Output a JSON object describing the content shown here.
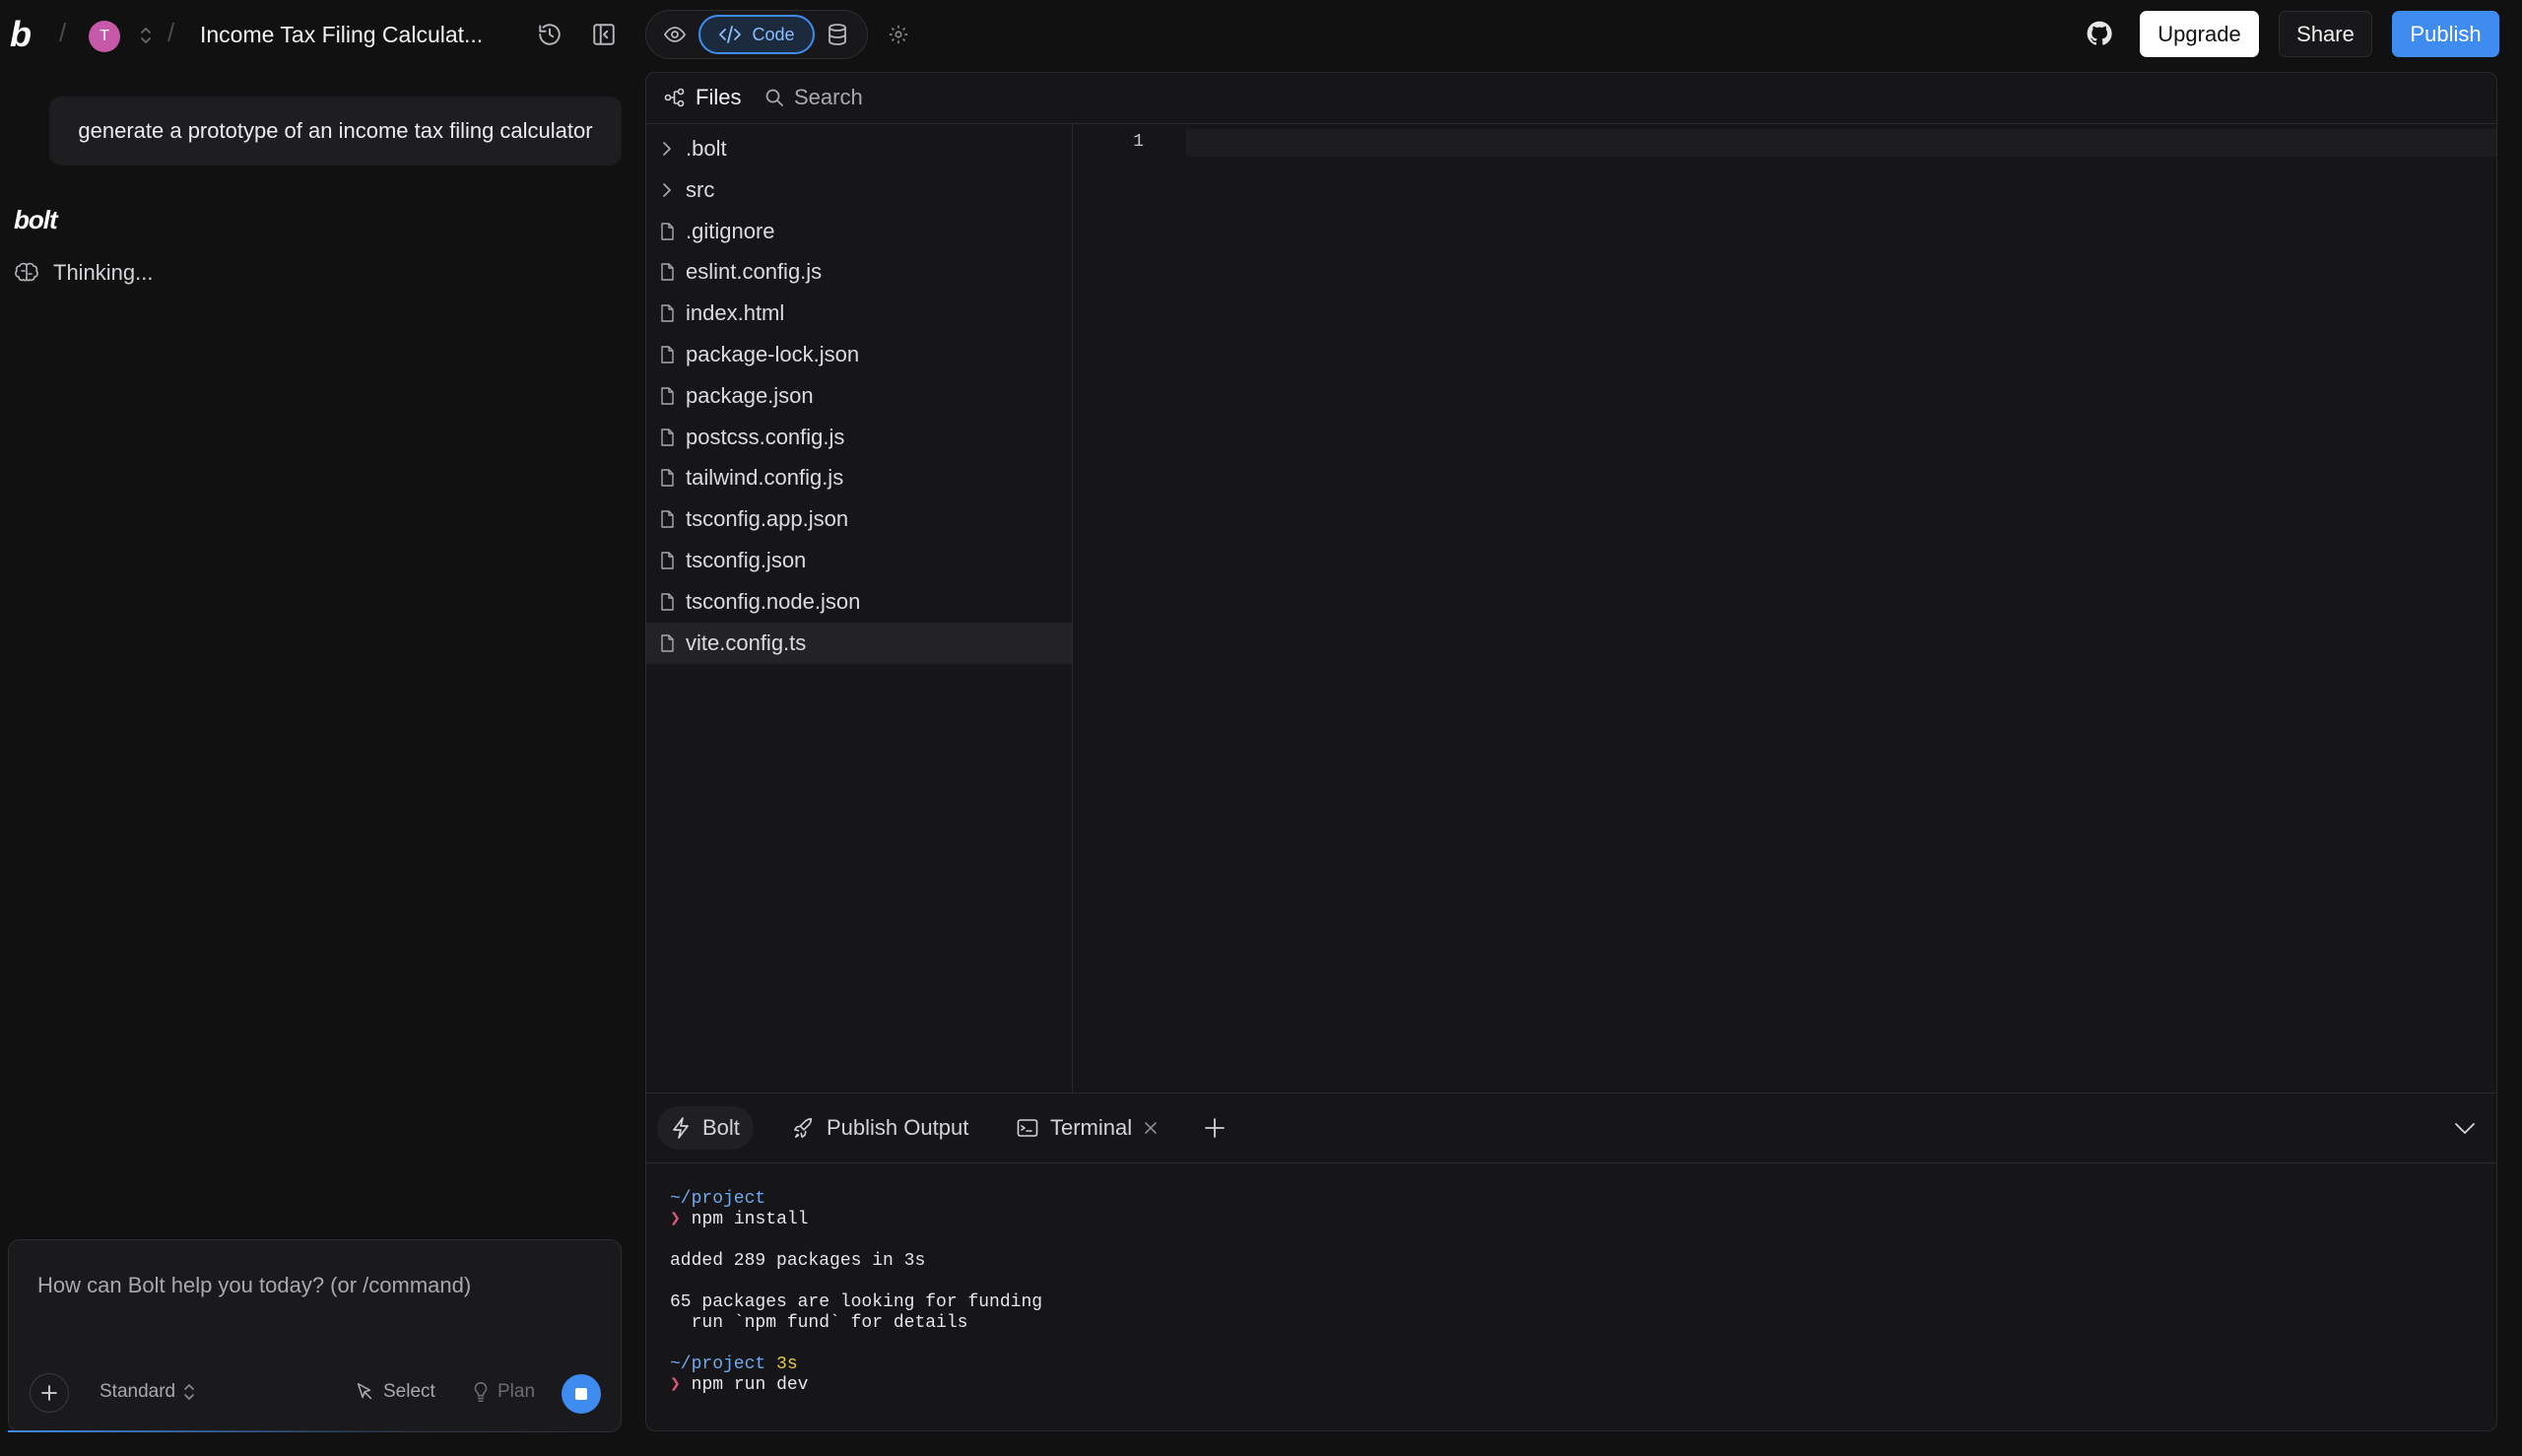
{
  "header": {
    "project_title": "Income Tax Filing Calculat...",
    "avatar_initial": "T",
    "code_label": "Code",
    "upgrade_label": "Upgrade",
    "share_label": "Share",
    "publish_label": "Publish"
  },
  "chat": {
    "user_message": "generate a prototype of an income tax filing calculator",
    "assistant_name": "bolt",
    "status": "Thinking...",
    "input_placeholder": "How can Bolt help you today? (or /command)",
    "mode_label": "Standard",
    "select_label": "Select",
    "plan_label": "Plan"
  },
  "files": {
    "files_tab": "Files",
    "search_tab": "Search",
    "items": [
      {
        "name": ".bolt",
        "type": "folder"
      },
      {
        "name": "src",
        "type": "folder"
      },
      {
        "name": ".gitignore",
        "type": "file"
      },
      {
        "name": "eslint.config.js",
        "type": "file"
      },
      {
        "name": "index.html",
        "type": "file"
      },
      {
        "name": "package-lock.json",
        "type": "file"
      },
      {
        "name": "package.json",
        "type": "file"
      },
      {
        "name": "postcss.config.js",
        "type": "file"
      },
      {
        "name": "tailwind.config.js",
        "type": "file"
      },
      {
        "name": "tsconfig.app.json",
        "type": "file"
      },
      {
        "name": "tsconfig.json",
        "type": "file"
      },
      {
        "name": "tsconfig.node.json",
        "type": "file"
      },
      {
        "name": "vite.config.ts",
        "type": "file",
        "selected": true
      }
    ]
  },
  "editor": {
    "line_number": "1"
  },
  "panel": {
    "tabs": {
      "bolt": "Bolt",
      "publish_output": "Publish Output",
      "terminal": "Terminal"
    },
    "terminal": {
      "path1": "~/project",
      "prompt_symbol": "❯",
      "cmd1": "npm install",
      "out1": "added 289 packages in 3s",
      "out2": "65 packages are looking for funding",
      "out3": "  run `npm fund` for details",
      "path2": "~/project",
      "time2": "3s",
      "cmd2": "npm run dev"
    }
  },
  "colors": {
    "accent": "#3f8cf0",
    "background": "#111112",
    "terminal_path": "#6fa8f0",
    "terminal_prompt": "#e0527a",
    "terminal_time": "#e5c74a"
  }
}
